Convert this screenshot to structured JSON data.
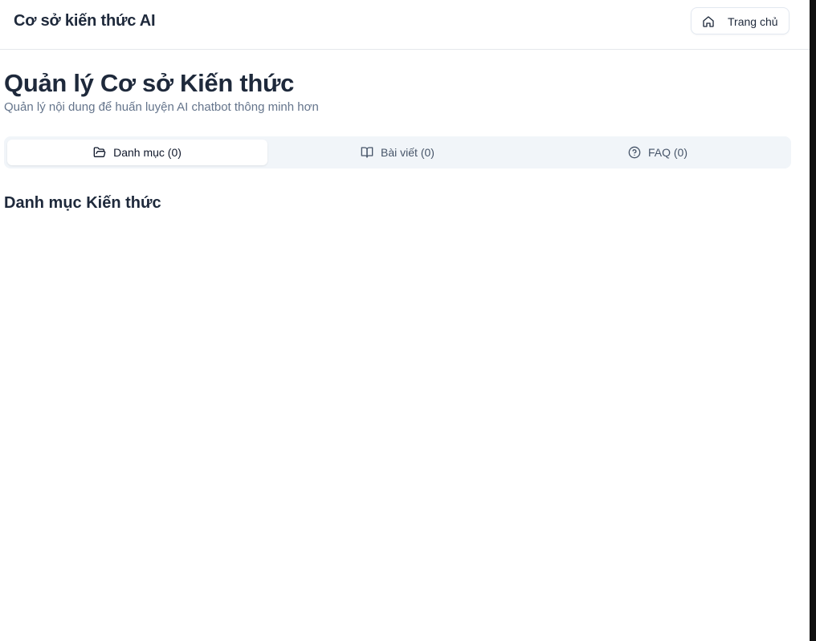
{
  "header": {
    "app_title": "Cơ sở kiến thức AI",
    "home_button": {
      "label": "Trang chủ",
      "icon": "home-icon"
    }
  },
  "main": {
    "title": "Quản lý Cơ sở Kiến thức",
    "subtitle": "Quản lý nội dung để huấn luyện AI chatbot thông minh hơn",
    "tabs": [
      {
        "label": "Danh mục (0)",
        "icon": "folder-open-icon",
        "active": true
      },
      {
        "label": "Bài viết (0)",
        "icon": "book-open-icon",
        "active": false
      },
      {
        "label": "FAQ (0)",
        "icon": "help-circle-icon",
        "active": false
      }
    ],
    "section_title": "Danh mục Kiến thức"
  },
  "colors": {
    "text": "#1e293b",
    "muted": "#64748b",
    "tab_bg": "#f1f5f9",
    "border": "#e5e7eb"
  }
}
